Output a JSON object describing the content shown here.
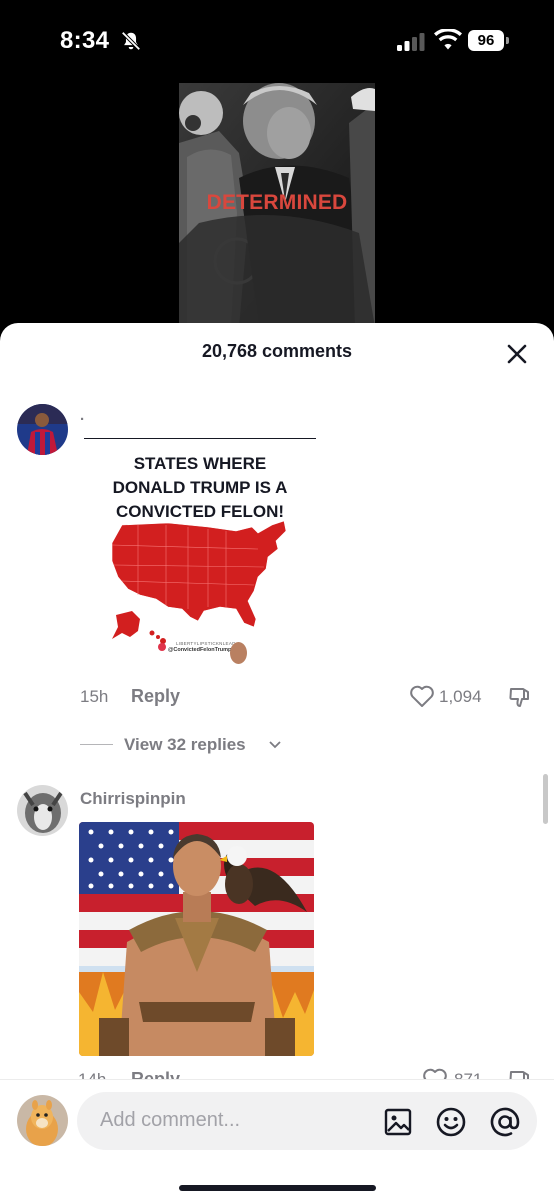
{
  "status_bar": {
    "time": "8:34",
    "battery": "96",
    "icons": [
      "bell-slash-icon",
      "cellular-signal-icon",
      "wifi-icon",
      "battery-icon"
    ]
  },
  "video": {
    "caption": "DETERMINED",
    "caption_color": "#d9473d"
  },
  "comments_sheet": {
    "title": "20,768 comments",
    "close_icon": "close-icon",
    "comments": [
      {
        "username": ".",
        "image": {
          "headline": "STATES WHERE\nDONALD TRUMP IS A\nCONVICTED FELON!",
          "map_color": "#d21f1f",
          "tag_line1": "LIBERTYLIPSTICKNLEAD",
          "tag_line2": "@ConvictedFelonTrump"
        },
        "time": "15h",
        "reply_label": "Reply",
        "like_count": "1,094",
        "view_replies": "View 32 replies"
      },
      {
        "username": "Chirrispinpin",
        "time": "14h",
        "reply_label": "Reply",
        "like_count": "871"
      }
    ]
  },
  "input_bar": {
    "placeholder": "Add comment...",
    "icons": [
      "image-icon",
      "emoji-icon",
      "mention-icon"
    ]
  }
}
